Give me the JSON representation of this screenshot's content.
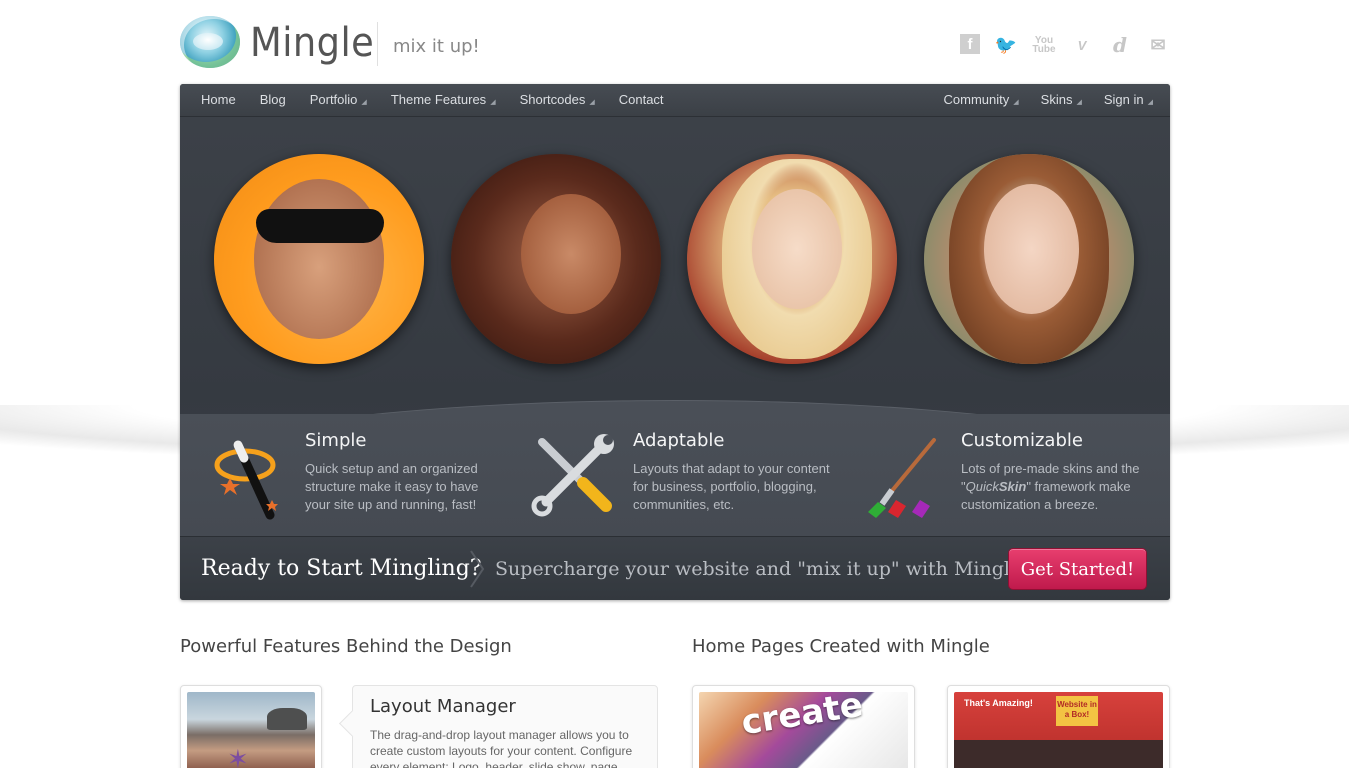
{
  "header": {
    "logo_text": "Mingle",
    "tagline": "mix it up!",
    "social": [
      {
        "icon": "facebook-icon",
        "glyph": "f"
      },
      {
        "icon": "twitter-icon",
        "glyph": "🐦"
      },
      {
        "icon": "youtube-icon",
        "glyph": "You Tube"
      },
      {
        "icon": "vimeo-icon",
        "glyph": "V"
      },
      {
        "icon": "delicious-icon",
        "glyph": "d"
      },
      {
        "icon": "email-icon",
        "glyph": "✉"
      }
    ]
  },
  "nav": {
    "left": [
      {
        "label": "Home",
        "dropdown": false
      },
      {
        "label": "Blog",
        "dropdown": false
      },
      {
        "label": "Portfolio",
        "dropdown": true
      },
      {
        "label": "Theme Features",
        "dropdown": true
      },
      {
        "label": "Shortcodes",
        "dropdown": true
      },
      {
        "label": "Contact",
        "dropdown": false
      }
    ],
    "right": [
      {
        "label": "Community",
        "dropdown": true
      },
      {
        "label": "Skins",
        "dropdown": true
      },
      {
        "label": "Sign in",
        "dropdown": true
      }
    ]
  },
  "features": [
    {
      "title": "Simple",
      "desc": "Quick setup and an organized structure make it easy to have your site up and running, fast!",
      "icon": "magic-wand-icon"
    },
    {
      "title": "Adaptable",
      "desc": "Layouts that adapt to your content for business, portfolio, blogging, communities, etc.",
      "icon": "wrench-screwdriver-icon"
    },
    {
      "title": "Customizable",
      "desc_prefix": "Lots of pre-made skins and the \"",
      "desc_em": "Quick",
      "desc_strong": "Skin",
      "desc_suffix": "\" framework make customization a breeze.",
      "icon": "paintbrush-icon"
    }
  ],
  "cta": {
    "title": "Ready to Start Mingling?",
    "subtitle": "Supercharge your website and \"mix it up\" with Mingle!",
    "button": "Get Started!"
  },
  "sections": {
    "left_heading": "Powerful Features Behind the Design",
    "right_heading": "Home Pages Created with Mingle",
    "layout_card_title": "Layout Manager",
    "layout_card_desc": "The drag-and-drop layout manager allows you to create custom layouts for your content. Configure every element: Logo, header, slide show, page",
    "create_word": "create",
    "box_text": "That's Amazing!",
    "box_badge": "Website in a Box!"
  },
  "colors": {
    "panel": "#3a3f46",
    "cta_button": "#d12a5a"
  }
}
